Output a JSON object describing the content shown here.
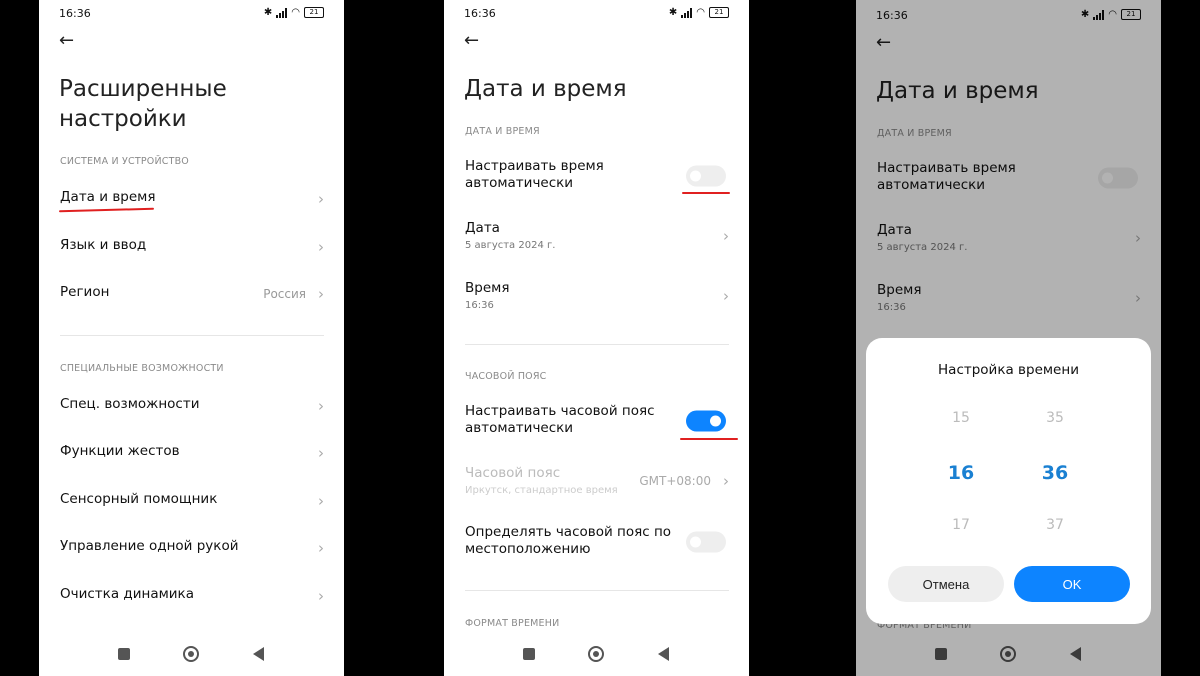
{
  "status": {
    "time": "16:36",
    "battery": "21"
  },
  "screen1": {
    "title_line1": "Расширенные",
    "title_line2": "настройки",
    "section1": "СИСТЕМА И УСТРОЙСТВО",
    "items1": [
      {
        "label": "Дата и время"
      },
      {
        "label": "Язык и ввод"
      },
      {
        "label": "Регион",
        "value": "Россия"
      }
    ],
    "section2": "СПЕЦИАЛЬНЫЕ ВОЗМОЖНОСТИ",
    "items2": [
      {
        "label": "Спец. возможности"
      },
      {
        "label": "Функции жестов"
      },
      {
        "label": "Сенсорный помощник"
      },
      {
        "label": "Управление одной рукой"
      },
      {
        "label": "Очистка динамика"
      }
    ]
  },
  "screen2": {
    "title": "Дата и время",
    "section_datetime": "ДАТА И ВРЕМЯ",
    "auto_time": {
      "line1": "Настраивать время",
      "line2": "автоматически",
      "enabled": false
    },
    "date": {
      "label": "Дата",
      "value": "5 августа 2024 г."
    },
    "time": {
      "label": "Время",
      "value": "16:36"
    },
    "section_tz": "ЧАСОВОЙ ПОЯС",
    "auto_tz": {
      "line1": "Настраивать часовой пояс",
      "line2": "автоматически",
      "enabled": true
    },
    "timezone": {
      "label": "Часовой пояс",
      "value": "Иркутск, стандартное время",
      "offset": "GMT+08:00"
    },
    "tz_location": {
      "line1": "Определять часовой пояс по",
      "line2": "местоположению",
      "enabled": false
    },
    "section_format": "ФОРМАТ ВРЕМЕНИ"
  },
  "screen3": {
    "title": "Дата и время",
    "section_datetime": "ДАТА И ВРЕМЯ",
    "auto_time": {
      "line1": "Настраивать время",
      "line2": "автоматически"
    },
    "date": {
      "label": "Дата",
      "value": "5 августа 2024 г."
    },
    "time": {
      "label": "Время",
      "value": "16:36"
    },
    "section_format_partial": "ФОРМАТ ВРЕМЕНИ",
    "dialog": {
      "title": "Настройка времени",
      "hours": [
        "15",
        "16",
        "17"
      ],
      "minutes": [
        "35",
        "36",
        "37"
      ],
      "cancel": "Отмена",
      "ok": "OK"
    }
  }
}
